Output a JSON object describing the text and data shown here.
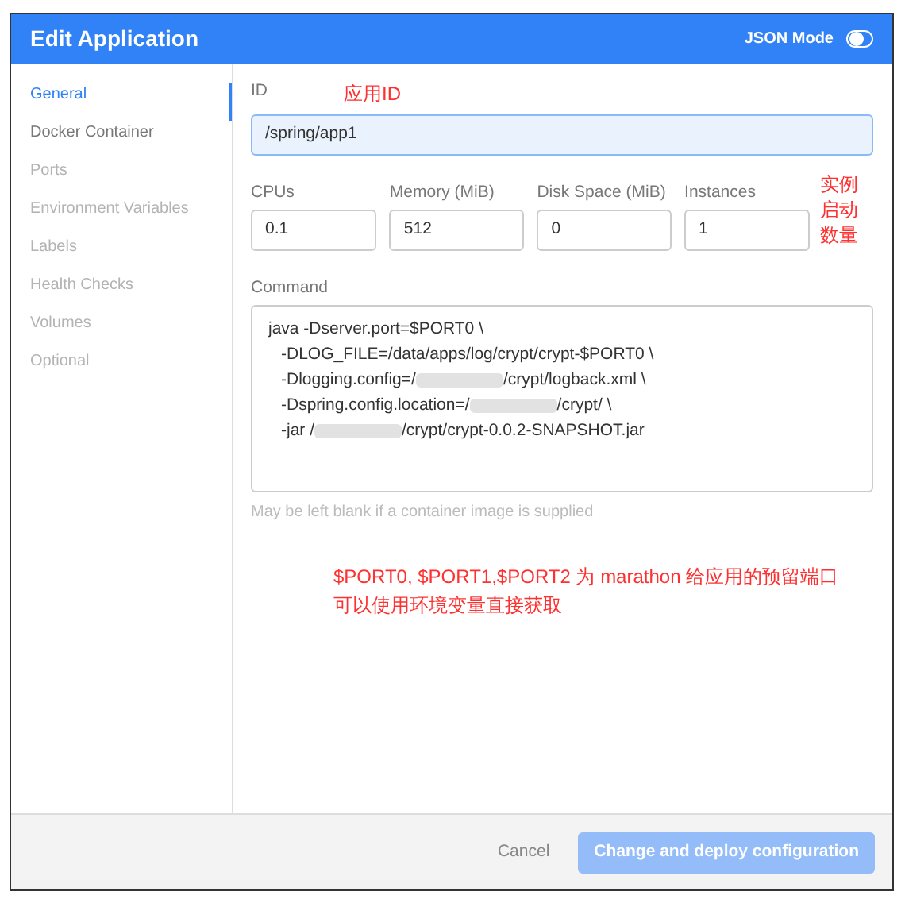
{
  "window": {
    "title": "Edit Application"
  },
  "json_mode": {
    "label": "JSON Mode",
    "on": false
  },
  "sidebar": {
    "items": [
      {
        "label": "General",
        "selected": true,
        "disabled": false
      },
      {
        "label": "Docker Container",
        "selected": false,
        "disabled": false
      },
      {
        "label": "Ports",
        "selected": false,
        "disabled": true
      },
      {
        "label": "Environment Variables",
        "selected": false,
        "disabled": true
      },
      {
        "label": "Labels",
        "selected": false,
        "disabled": true
      },
      {
        "label": "Health Checks",
        "selected": false,
        "disabled": true
      },
      {
        "label": "Volumes",
        "selected": false,
        "disabled": true
      },
      {
        "label": "Optional",
        "selected": false,
        "disabled": true
      }
    ]
  },
  "id_field": {
    "label": "ID",
    "value": "/spring/app1",
    "focused": true,
    "annotation": "应用ID"
  },
  "resources": [
    {
      "label": "CPUs",
      "value": "0.1"
    },
    {
      "label": "Memory (MiB)",
      "value": "512"
    },
    {
      "label": "Disk Space (MiB)",
      "value": "0"
    },
    {
      "label": "Instances",
      "value": "1"
    }
  ],
  "instances_annotation": "实例启动数量",
  "command": {
    "label": "Command",
    "lines": [
      {
        "before": "java -Dserver.port=$PORT0 \\",
        "redacted": false
      },
      {
        "before": "-DLOG_FILE=/data/apps/log/crypt/crypt-$PORT0 \\",
        "redacted": false
      },
      {
        "before": "-Dlogging.config=/",
        "redacted": true,
        "after": "/crypt/logback.xml \\"
      },
      {
        "before": "-Dspring.config.location=/",
        "redacted": true,
        "after": "/crypt/ \\"
      },
      {
        "before": "-jar /",
        "redacted": true,
        "after": "/crypt/crypt-0.0.2-SNAPSHOT.jar"
      }
    ],
    "help": "May be left blank if a container image is supplied"
  },
  "annotations": [
    "$PORT0, $PORT1,$PORT2 为 marathon 给应用的预留端口",
    "可以使用环境变量直接获取"
  ],
  "footer": {
    "cancel": "Cancel",
    "submit": "Change and deploy configuration",
    "submit_disabled": true
  }
}
